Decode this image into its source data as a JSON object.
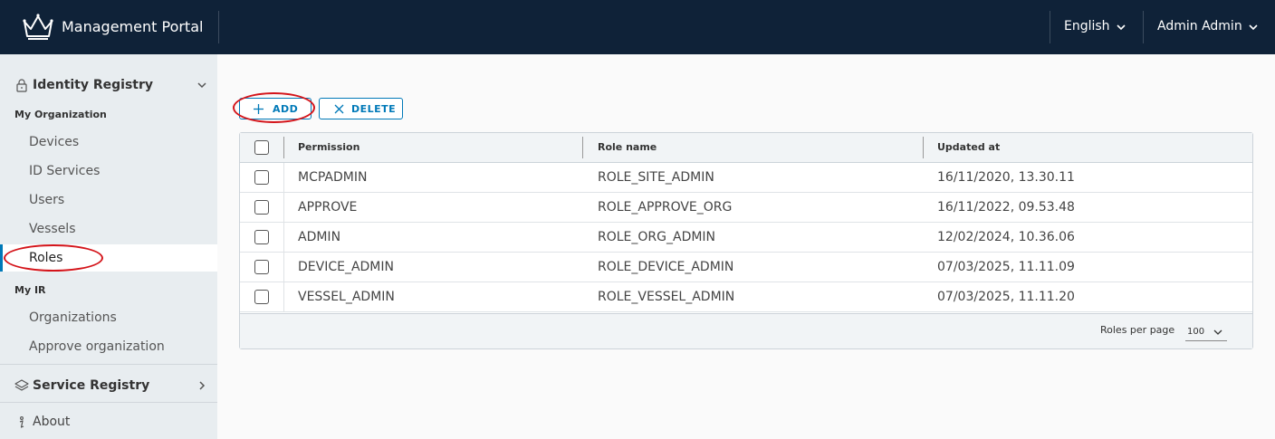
{
  "header": {
    "title": "Management Portal",
    "language": "English",
    "user": "Admin Admin",
    "brand_color": "#0f2238"
  },
  "sidebar": {
    "identity_registry": {
      "label": "Identity Registry",
      "icon": "lock-icon"
    },
    "my_organization_label": "My Organization",
    "org_items": [
      "Devices",
      "ID Services",
      "Users",
      "Vessels",
      "Roles"
    ],
    "active_item": "Roles",
    "my_ir_label": "My IR",
    "ir_items": [
      "Organizations",
      "Approve organization"
    ],
    "service_registry": {
      "label": "Service Registry",
      "icon": "layers-icon"
    },
    "about": {
      "label": "About",
      "icon": "info-icon"
    }
  },
  "toolbar": {
    "add_label": "ADD",
    "delete_label": "DELETE",
    "accent_color": "#0079b8"
  },
  "table": {
    "columns": [
      "Permission",
      "Role name",
      "Updated at"
    ],
    "rows": [
      {
        "permission": "MCPADMIN",
        "role_name": "ROLE_SITE_ADMIN",
        "updated_at": "16/11/2020, 13.30.11"
      },
      {
        "permission": "APPROVE",
        "role_name": "ROLE_APPROVE_ORG",
        "updated_at": "16/11/2022, 09.53.48"
      },
      {
        "permission": "ADMIN",
        "role_name": "ROLE_ORG_ADMIN",
        "updated_at": "12/02/2024, 10.36.06"
      },
      {
        "permission": "DEVICE_ADMIN",
        "role_name": "ROLE_DEVICE_ADMIN",
        "updated_at": "07/03/2025, 11.11.09"
      },
      {
        "permission": "VESSEL_ADMIN",
        "role_name": "ROLE_VESSEL_ADMIN",
        "updated_at": "07/03/2025, 11.11.20"
      }
    ],
    "footer": {
      "per_page_label": "Roles per page",
      "per_page_value": "100"
    }
  },
  "annotation_color": "#d4141a"
}
